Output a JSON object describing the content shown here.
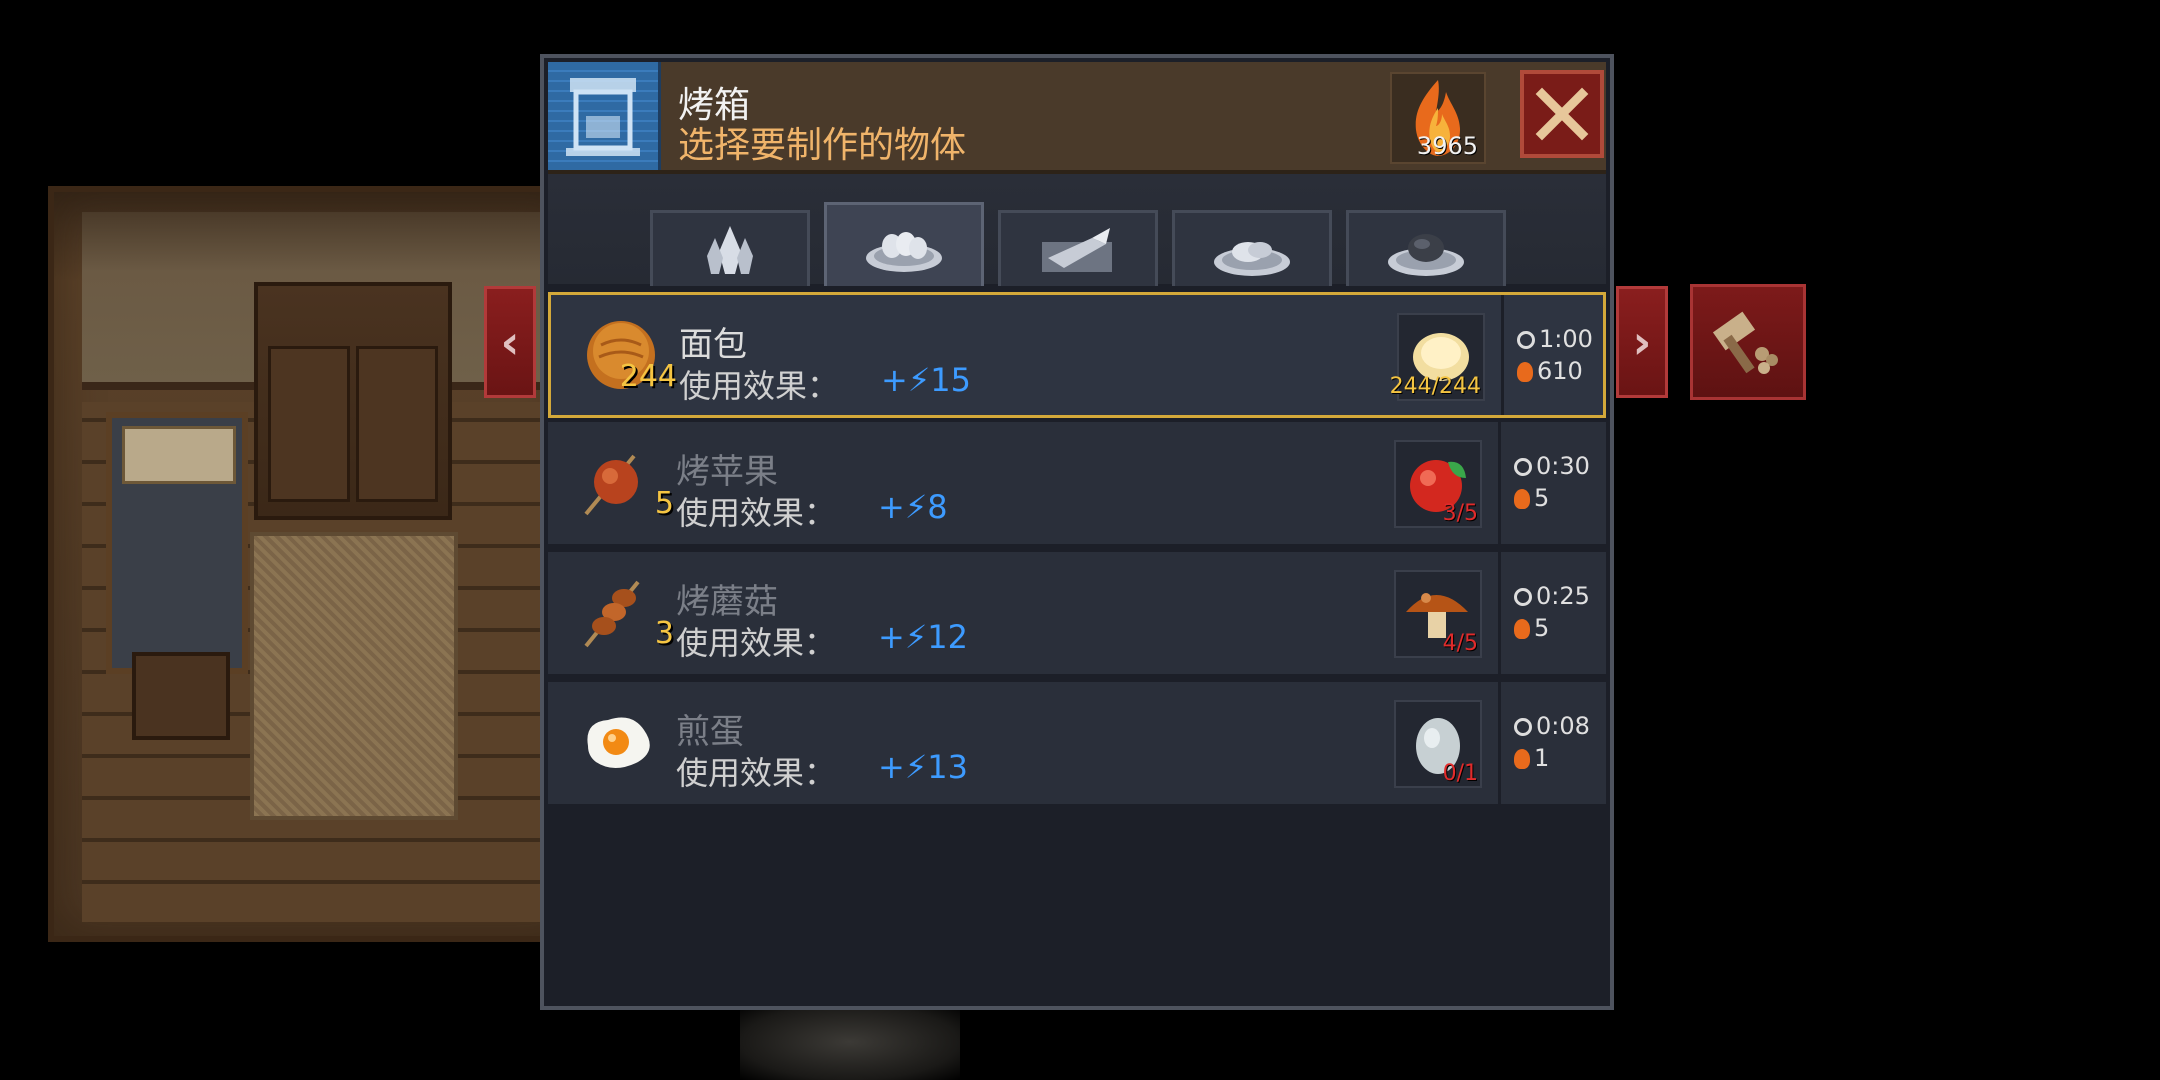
{
  "header": {
    "title": "烤箱",
    "subtitle": "选择要制作的物体",
    "fuel_amount": "3965"
  },
  "tabs": [
    {
      "id": "fire",
      "icon": "crystal-icon",
      "active": false
    },
    {
      "id": "bread",
      "icon": "bread-plate-icon",
      "active": true
    },
    {
      "id": "fish",
      "icon": "fish-plate-icon",
      "active": false
    },
    {
      "id": "meat",
      "icon": "meat-plate-icon",
      "active": false
    },
    {
      "id": "stone",
      "icon": "stone-plate-icon",
      "active": false
    }
  ],
  "recipes": [
    {
      "name": "面包",
      "count": "244",
      "effect_label": "使用效果：",
      "effect_value": "+⚡15",
      "ingredient_count": "244/244",
      "time": "1:00",
      "fuel": "610",
      "selected": true
    },
    {
      "name": "烤苹果",
      "count": "5",
      "effect_label": "使用效果：",
      "effect_value": "+⚡8",
      "ingredient_count": "3/5",
      "time": "0:30",
      "fuel": "5"
    },
    {
      "name": "烤蘑菇",
      "count": "3",
      "effect_label": "使用效果：",
      "effect_value": "+⚡12",
      "ingredient_count": "4/5",
      "time": "0:25",
      "fuel": "5"
    },
    {
      "name": "煎蛋",
      "count": "",
      "effect_label": "使用效果：",
      "effect_value": "+⚡13",
      "ingredient_count": "0/1",
      "time": "0:08",
      "fuel": "1"
    }
  ],
  "nav": {
    "prev": "‹",
    "next": "›"
  },
  "colors": {
    "accent_gold": "#d4a93a",
    "effect_blue": "#3d9bff",
    "count_yellow": "#f5c542",
    "insufficient_red": "#e12b2b"
  }
}
